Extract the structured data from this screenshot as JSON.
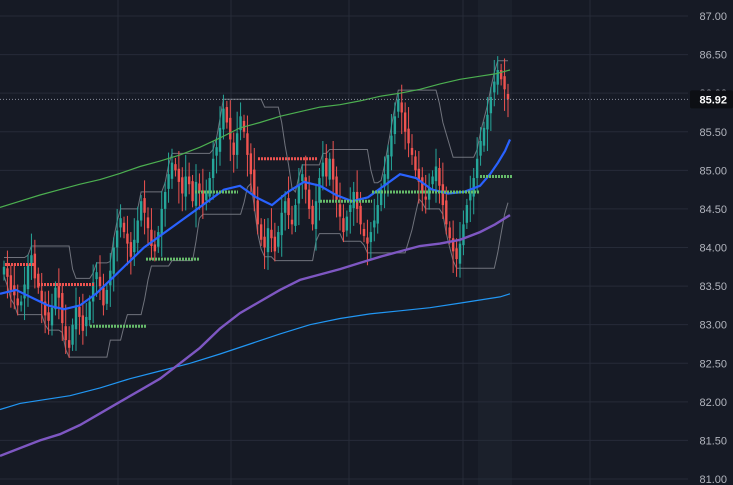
{
  "chart_data": {
    "type": "line",
    "title": "",
    "xlabel": "",
    "ylabel": "",
    "ylim": [
      81.0,
      87.0
    ],
    "y_ticks": [
      "87.00",
      "86.50",
      "86.00",
      "85.50",
      "85.00",
      "84.50",
      "84.00",
      "83.50",
      "83.00",
      "82.50",
      "82.00",
      "81.50",
      "81.00"
    ],
    "current_price": "85.92",
    "grid": true,
    "colors": {
      "background": "#161a25",
      "grid": "#262b38",
      "candle_up": "#26a69a",
      "candle_down": "#ef5350",
      "upper_band": "#4caf50",
      "envelope": "#9598a1",
      "ma_fast": "#2962ff",
      "ma_mid": "#7e57c2",
      "ma_slow": "#2196f3",
      "level_high": "#ef5350",
      "level_low": "#66bb6a",
      "badge": "#0d0f14"
    },
    "candle_closes": [
      83.75,
      83.62,
      83.45,
      83.38,
      83.25,
      83.3,
      83.52,
      83.78,
      83.9,
      83.6,
      83.48,
      83.3,
      83.12,
      83.05,
      83.22,
      83.48,
      83.35,
      83.02,
      82.8,
      82.7,
      83.0,
      83.25,
      83.1,
      82.92,
      83.1,
      83.3,
      83.55,
      83.68,
      83.5,
      83.25,
      83.45,
      83.7,
      84.0,
      84.22,
      84.38,
      84.2,
      84.05,
      83.88,
      84.1,
      84.35,
      84.6,
      84.45,
      84.25,
      84.02,
      83.95,
      84.2,
      84.5,
      84.72,
      84.95,
      85.1,
      85.0,
      84.85,
      84.7,
      84.92,
      84.82,
      84.6,
      84.85,
      84.72,
      84.55,
      84.7,
      84.9,
      85.15,
      85.3,
      85.55,
      85.8,
      85.62,
      85.4,
      85.2,
      85.48,
      85.7,
      85.5,
      85.2,
      84.95,
      84.65,
      84.3,
      84.1,
      84.0,
      84.25,
      84.12,
      83.95,
      84.2,
      84.45,
      84.6,
      84.42,
      84.3,
      84.55,
      84.8,
      84.95,
      84.75,
      84.5,
      84.3,
      84.6,
      84.9,
      85.1,
      84.92,
      85.15,
      84.88,
      84.62,
      84.4,
      84.2,
      84.4,
      84.55,
      84.72,
      84.5,
      84.3,
      84.15,
      84.05,
      84.2,
      84.35,
      84.55,
      84.75,
      84.95,
      85.2,
      85.45,
      85.7,
      85.92,
      85.75,
      85.5,
      85.35,
      85.2,
      85.0,
      84.85,
      84.7,
      84.62,
      84.78,
      84.92,
      85.05,
      84.8,
      84.55,
      84.3,
      84.12,
      83.95,
      83.85,
      84.05,
      84.3,
      84.55,
      84.7,
      84.9,
      85.15,
      85.38,
      85.55,
      85.72,
      85.95,
      86.15,
      86.3,
      86.18,
      86.05,
      85.92
    ],
    "upper_band": [
      84.52,
      84.6,
      84.68,
      84.75,
      84.82,
      84.88,
      84.96,
      85.05,
      85.12,
      85.2,
      85.3,
      85.42,
      85.55,
      85.62,
      85.7,
      85.76,
      85.82,
      85.85,
      85.9,
      85.96,
      86.0,
      86.05,
      86.12,
      86.18,
      86.22,
      86.25,
      86.3
    ],
    "upper_band_x": [
      0,
      20,
      40,
      60,
      80,
      100,
      120,
      140,
      160,
      180,
      200,
      220,
      240,
      260,
      280,
      300,
      320,
      340,
      360,
      380,
      400,
      420,
      440,
      460,
      480,
      495,
      510
    ],
    "ma_fast": [
      83.4,
      83.45,
      83.35,
      83.25,
      83.2,
      83.25,
      83.4,
      83.6,
      83.8,
      84.0,
      84.3,
      84.45,
      84.75,
      84.8,
      84.65,
      84.55,
      84.72,
      84.85,
      84.8,
      84.68,
      84.6,
      84.65,
      84.8,
      84.95,
      84.9,
      84.75,
      84.7,
      84.72,
      84.8,
      84.95,
      85.1,
      85.25,
      85.4
    ],
    "ma_fast_x": [
      0,
      16,
      32,
      48,
      64,
      80,
      96,
      112,
      128,
      144,
      176,
      192,
      224,
      240,
      256,
      272,
      288,
      304,
      320,
      336,
      352,
      368,
      384,
      400,
      416,
      432,
      448,
      464,
      480,
      490,
      498,
      505,
      510
    ],
    "ma_mid": [
      81.3,
      81.4,
      81.5,
      81.58,
      81.7,
      81.85,
      82.0,
      82.15,
      82.3,
      82.5,
      82.7,
      82.95,
      83.15,
      83.3,
      83.45,
      83.58,
      83.65,
      83.72,
      83.8,
      83.88,
      83.95,
      84.02,
      84.05,
      84.1,
      84.2,
      84.3,
      84.42
    ],
    "ma_mid_x": [
      0,
      20,
      40,
      60,
      80,
      100,
      120,
      140,
      160,
      180,
      200,
      220,
      240,
      260,
      280,
      300,
      320,
      340,
      360,
      380,
      400,
      420,
      440,
      460,
      480,
      495,
      510
    ],
    "ma_slow": [
      81.9,
      81.98,
      82.02,
      82.08,
      82.18,
      82.3,
      82.4,
      82.5,
      82.62,
      82.75,
      82.88,
      83.0,
      83.08,
      83.14,
      83.18,
      83.22,
      83.28,
      83.32,
      83.36,
      83.4
    ],
    "ma_slow_x": [
      0,
      20,
      40,
      70,
      100,
      130,
      160,
      190,
      220,
      250,
      280,
      310,
      340,
      370,
      400,
      430,
      460,
      480,
      500,
      510
    ],
    "levels_high": [
      {
        "x0": 5,
        "x1": 35,
        "value": 83.78
      },
      {
        "x0": 38,
        "x1": 95,
        "value": 83.52
      },
      {
        "x0": 258,
        "x1": 318,
        "value": 85.15
      }
    ],
    "levels_low": [
      {
        "x0": 90,
        "x1": 146,
        "value": 82.98
      },
      {
        "x0": 146,
        "x1": 200,
        "value": 83.85
      },
      {
        "x0": 195,
        "x1": 238,
        "value": 84.72
      },
      {
        "x0": 320,
        "x1": 372,
        "value": 84.6
      },
      {
        "x0": 372,
        "x1": 480,
        "value": 84.72
      },
      {
        "x0": 480,
        "x1": 512,
        "value": 84.92
      }
    ]
  }
}
